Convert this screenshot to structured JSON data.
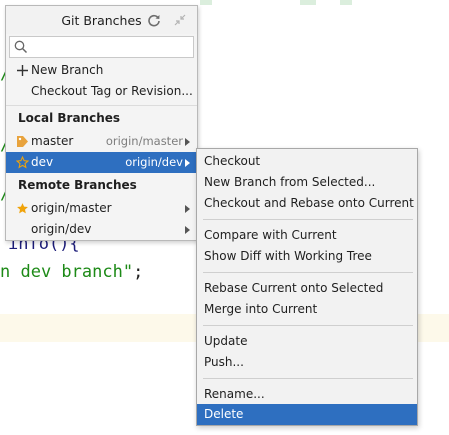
{
  "editor": {
    "fragments": [
      {
        "text": "info(){",
        "style": "dark"
      },
      {
        "text": "n dev branch\"",
        "style": "string"
      },
      {
        "text": ";",
        "style": "black"
      }
    ]
  },
  "popup": {
    "title": "Git Branches",
    "search_placeholder": "",
    "actions": [
      {
        "label": "New Branch",
        "icon": "plus-icon"
      },
      {
        "label": "Checkout Tag or Revision...",
        "icon": ""
      }
    ],
    "local_header": "Local Branches",
    "local_branches": [
      {
        "name": "master",
        "tracking": "origin/master",
        "icon": "tag-icon",
        "selected": false
      },
      {
        "name": "dev",
        "tracking": "origin/dev",
        "icon": "star-outline-icon",
        "selected": true
      }
    ],
    "remote_header": "Remote Branches",
    "remote_branches": [
      {
        "name": "origin/master",
        "icon": "star-filled-icon"
      },
      {
        "name": "origin/dev",
        "icon": ""
      }
    ]
  },
  "context_menu": {
    "groups": [
      [
        "Checkout",
        "New Branch from Selected...",
        "Checkout and Rebase onto Current"
      ],
      [
        "Compare with Current",
        "Show Diff with Working Tree"
      ],
      [
        "Rebase Current onto Selected",
        "Merge into Current"
      ],
      [
        "Update",
        "Push..."
      ],
      [
        "Rename...",
        "Delete"
      ]
    ],
    "active_item": "Delete"
  },
  "colors": {
    "selection": "#2e6fc0",
    "star": "#f0a30a",
    "tag": "#e8a33d",
    "code_green": "#1d8a17",
    "code_dark": "#1d1d7a"
  }
}
